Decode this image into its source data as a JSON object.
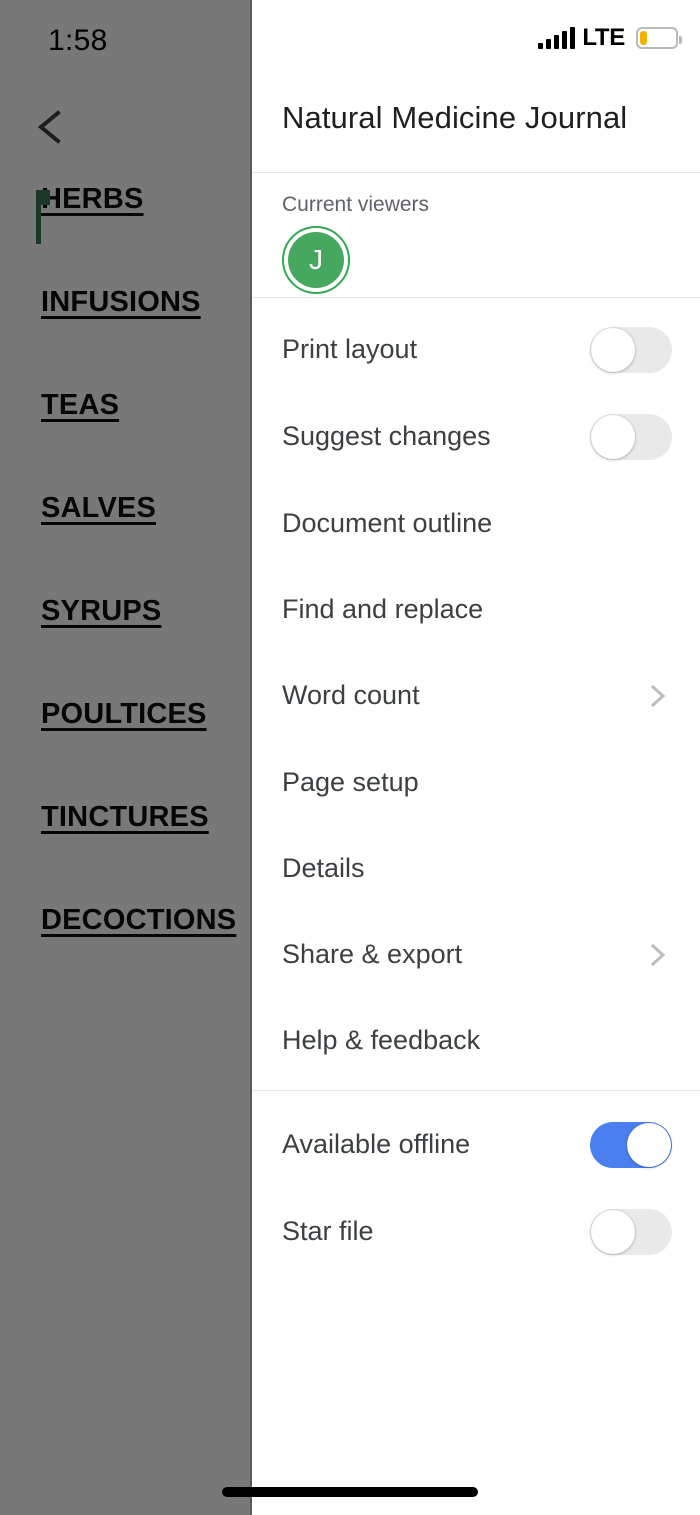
{
  "status_bar": {
    "clock": "1:58",
    "network_label": "LTE",
    "signal_icon": "signal-bars-icon",
    "battery_icon": "battery-low-icon",
    "battery_level_percent": 18,
    "battery_color": "#f2b300"
  },
  "document": {
    "back_icon": "chevron-left-icon",
    "headings": [
      {
        "label": "HERBS"
      },
      {
        "label": "INFUSIONS"
      },
      {
        "label": "TEAS"
      },
      {
        "label": "SALVES"
      },
      {
        "label": "SYRUPS"
      },
      {
        "label": "POULTICES"
      },
      {
        "label": "TINCTURES"
      },
      {
        "label": "DECOCTIONS"
      }
    ],
    "collaborator_caret_color": "#3b7a52"
  },
  "panel": {
    "title": "Natural Medicine Journal",
    "viewers": {
      "label": "Current viewers",
      "avatars": [
        {
          "initial": "J",
          "color": "#45a85e",
          "ring_color": "#34a853"
        }
      ]
    },
    "menu_items": [
      {
        "label": "Print layout",
        "control": "toggle",
        "state": "off"
      },
      {
        "label": "Suggest changes",
        "control": "toggle",
        "state": "off"
      },
      {
        "label": "Document outline",
        "control": "none",
        "state": ""
      },
      {
        "label": "Find and replace",
        "control": "none",
        "state": ""
      },
      {
        "label": "Word count",
        "control": "chevron",
        "state": ""
      },
      {
        "label": "Page setup",
        "control": "none",
        "state": ""
      },
      {
        "label": "Details",
        "control": "none",
        "state": ""
      },
      {
        "label": "Share & export",
        "control": "chevron",
        "state": ""
      },
      {
        "label": "Help & feedback",
        "control": "none",
        "state": ""
      }
    ],
    "bottom_items": [
      {
        "label": "Available offline",
        "control": "toggle",
        "state": "on"
      },
      {
        "label": "Star file",
        "control": "toggle",
        "state": "off"
      }
    ],
    "toggle_on_color": "#4a7ff0",
    "toggle_off_color": "#e9e9e9"
  },
  "system": {
    "home_indicator": "home-indicator"
  }
}
